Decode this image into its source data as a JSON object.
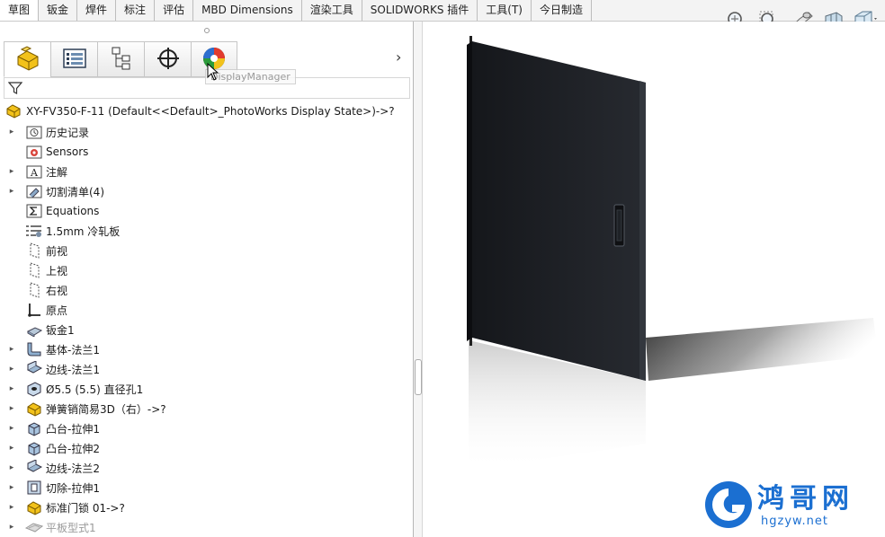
{
  "command_tabs": [
    "草图",
    "钣金",
    "焊件",
    "标注",
    "评估",
    "MBD Dimensions",
    "渲染工具",
    "SOLIDWORKS 插件",
    "工具(T)",
    "今日制造"
  ],
  "manager_tabs": [
    {
      "icon": "feature-manager-icon"
    },
    {
      "icon": "property-manager-icon"
    },
    {
      "icon": "configuration-manager-icon"
    },
    {
      "icon": "dimxpert-manager-icon"
    },
    {
      "icon": "display-manager-icon"
    }
  ],
  "tooltip": "DisplayManager",
  "tree": {
    "root": "XY-FV350-F-11  (Default<<Default>_PhotoWorks Display State>)->?",
    "items": [
      {
        "label": "历史记录",
        "icon": "history-folder-icon",
        "expand": true
      },
      {
        "label": "Sensors",
        "icon": "sensors-folder-icon",
        "expand": false
      },
      {
        "label": "注解",
        "icon": "annotations-icon",
        "expand": true
      },
      {
        "label": "切割清单(4)",
        "icon": "cut-list-icon",
        "expand": true
      },
      {
        "label": "Equations",
        "icon": "equations-icon",
        "expand": false
      },
      {
        "label": "1.5mm 冷轧板",
        "icon": "material-icon",
        "expand": false
      },
      {
        "label": "前视",
        "icon": "plane-icon",
        "expand": false
      },
      {
        "label": "上视",
        "icon": "plane-icon",
        "expand": false
      },
      {
        "label": "右视",
        "icon": "plane-icon",
        "expand": false
      },
      {
        "label": "原点",
        "icon": "origin-icon",
        "expand": false
      },
      {
        "label": "钣金1",
        "icon": "sheet-metal-icon",
        "expand": false
      },
      {
        "label": "基体-法兰1",
        "icon": "base-flange-icon",
        "expand": true
      },
      {
        "label": "边线-法兰1",
        "icon": "edge-flange-icon",
        "expand": true
      },
      {
        "label": "Ø5.5 (5.5) 直径孔1",
        "icon": "hole-wizard-icon",
        "expand": true
      },
      {
        "label": "弹簧销简易3D（右）->?",
        "icon": "part-icon",
        "expand": true
      },
      {
        "label": "凸台-拉伸1",
        "icon": "boss-extrude-icon",
        "expand": true
      },
      {
        "label": "凸台-拉伸2",
        "icon": "boss-extrude-icon",
        "expand": true
      },
      {
        "label": "边线-法兰2",
        "icon": "edge-flange-icon",
        "expand": true
      },
      {
        "label": "切除-拉伸1",
        "icon": "cut-extrude-icon",
        "expand": true
      },
      {
        "label": "标准门锁 01->?",
        "icon": "part-icon",
        "expand": true
      },
      {
        "label": "平板型式1",
        "icon": "flat-pattern-icon",
        "expand": true,
        "dim": true
      }
    ]
  },
  "view_tools": [
    "zoom-to-fit-icon",
    "zoom-to-area-icon",
    "previous-view-icon",
    "section-view-icon",
    "view-orientation-icon"
  ],
  "watermark": {
    "brand": "鸿哥网",
    "url": "hgzyw.net"
  },
  "colors": {
    "accent": "#1b6fd1",
    "door": "#1e2126",
    "yellow": "#f2c21b"
  }
}
